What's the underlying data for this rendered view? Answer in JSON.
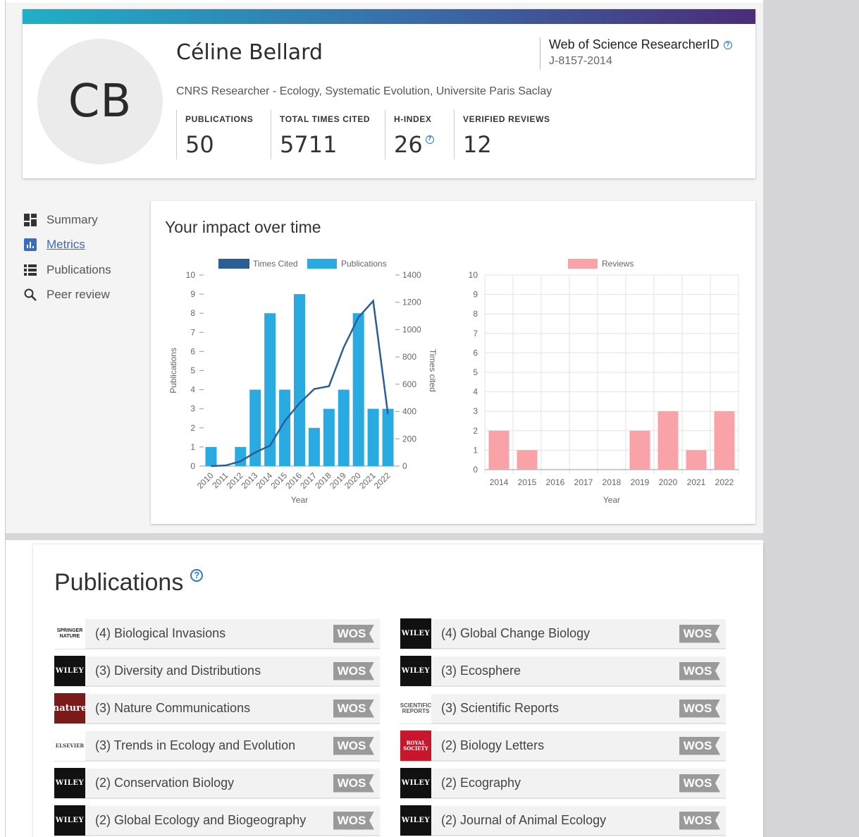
{
  "profile": {
    "initials": "CB",
    "name": "Céline Bellard",
    "affiliation": "CNRS Researcher - Ecology, Systematic Evolution, Universite Paris Saclay",
    "researcher_id_label": "Web of Science ResearcherID",
    "researcher_id": "J-8157-2014",
    "stats": [
      {
        "label": "PUBLICATIONS",
        "value": "50"
      },
      {
        "label": "TOTAL TIMES CITED",
        "value": "5711"
      },
      {
        "label": "H-INDEX",
        "value": "26"
      },
      {
        "label": "VERIFIED REVIEWS",
        "value": "12"
      }
    ]
  },
  "nav": [
    {
      "label": "Summary",
      "icon": "dashboard-icon",
      "active": false
    },
    {
      "label": "Metrics",
      "icon": "bar-chart-icon",
      "active": true
    },
    {
      "label": "Publications",
      "icon": "list-icon",
      "active": false
    },
    {
      "label": "Peer review",
      "icon": "search-icon",
      "active": false
    }
  ],
  "impact": {
    "title": "Your impact over time"
  },
  "chart_data": [
    {
      "type": "bar",
      "categories": [
        "2010",
        "2011",
        "2012",
        "2013",
        "2014",
        "2015",
        "2016",
        "2017",
        "2018",
        "2019",
        "2020",
        "2021",
        "2022"
      ],
      "series": [
        {
          "name": "Publications",
          "type": "bar",
          "color": "#29abe2",
          "values": [
            1,
            0,
            1,
            4,
            8,
            4,
            9,
            2,
            3,
            4,
            8,
            3,
            3
          ]
        },
        {
          "name": "Times Cited",
          "type": "line",
          "color": "#2c5e96",
          "values": [
            0,
            5,
            35,
            100,
            150,
            330,
            460,
            565,
            585,
            870,
            1090,
            1210,
            380
          ]
        }
      ],
      "xlabel": "Year",
      "ylabel": "Publications",
      "y2label": "Times cited",
      "ylim": [
        0,
        10
      ],
      "y2lim": [
        0,
        1400
      ],
      "y_ticks": [
        "0",
        "1",
        "2",
        "3",
        "4",
        "5",
        "6",
        "7",
        "8",
        "9",
        "10"
      ],
      "y2_ticks": [
        "0",
        "200",
        "400",
        "600",
        "800",
        "1000",
        "1200",
        "1400"
      ],
      "legend": "top"
    },
    {
      "type": "bar",
      "categories": [
        "2014",
        "2015",
        "2016",
        "2017",
        "2018",
        "2019",
        "2020",
        "2021",
        "2022"
      ],
      "series": [
        {
          "name": "Reviews",
          "color": "#f9a2a8",
          "values": [
            2,
            1,
            0,
            0,
            0,
            2,
            3,
            1,
            3
          ]
        }
      ],
      "xlabel": "Year",
      "ylim": [
        0,
        10
      ],
      "y_ticks": [
        "0",
        "1",
        "2",
        "3",
        "4",
        "5",
        "6",
        "7",
        "8",
        "9",
        "10"
      ],
      "grid": true,
      "legend": "top"
    }
  ],
  "publications": {
    "title": "Publications",
    "badge": "WOS",
    "left": [
      {
        "label": "(4) Biological Invasions",
        "logo": "springer-nature-logo",
        "logo_text": "SPRINGER NATURE"
      },
      {
        "label": "(3) Diversity and Distributions",
        "logo": "wiley-logo",
        "logo_text": "WILEY"
      },
      {
        "label": "(3) Nature Communications",
        "logo": "nature-logo",
        "logo_text": "nature"
      },
      {
        "label": "(3) Trends in Ecology and Evolution",
        "logo": "elsevier-logo",
        "logo_text": "ELSEVIER"
      },
      {
        "label": "(2) Conservation Biology",
        "logo": "wiley-logo",
        "logo_text": "WILEY"
      },
      {
        "label": "(2) Global Ecology and Biogeography",
        "logo": "wiley-logo",
        "logo_text": "WILEY"
      }
    ],
    "right": [
      {
        "label": "(4) Global Change Biology",
        "logo": "wiley-logo",
        "logo_text": "WILEY"
      },
      {
        "label": "(3) Ecosphere",
        "logo": "wiley-logo",
        "logo_text": "WILEY"
      },
      {
        "label": "(3) Scientific Reports",
        "logo": "scientific-reports-logo",
        "logo_text": "SCIENTIFIC REPORTS"
      },
      {
        "label": "(2) Biology Letters",
        "logo": "royal-society-logo",
        "logo_text": "ROYAL SOCIETY"
      },
      {
        "label": "(2) Ecography",
        "logo": "wiley-logo",
        "logo_text": "WILEY"
      },
      {
        "label": "(2) Journal of Animal Ecology",
        "logo": "wiley-logo",
        "logo_text": "WILEY"
      }
    ]
  }
}
